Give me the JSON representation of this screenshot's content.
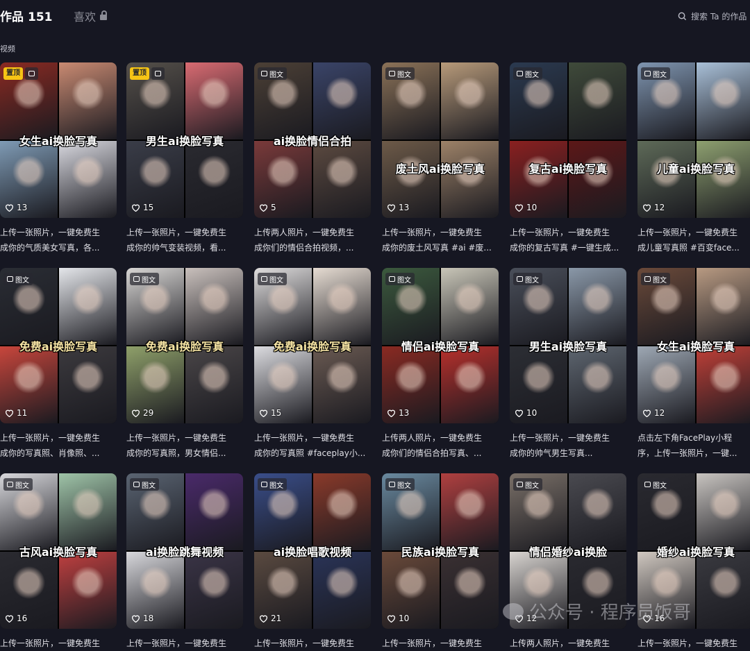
{
  "tabs": {
    "works_label": "作品",
    "works_count": "151",
    "likes_label": "喜欢"
  },
  "search": {
    "placeholder": "搜索 Ta 的作品"
  },
  "section_label": "视频",
  "cards": [
    {
      "pinned": true,
      "tag": "",
      "title": "女生ai换脸写真",
      "likes": "13",
      "desc1": "上传一张照片，一键免费生",
      "desc2": "成你的气质美女写真，各...",
      "colors": [
        "#8a2a22",
        "#c98a72",
        "#7f9bb5",
        "#d9d9e0"
      ],
      "title_style": "white",
      "title_pos": "mid"
    },
    {
      "pinned": true,
      "tag": "",
      "title": "男生ai换脸写真",
      "likes": "15",
      "desc1": "上传一张照片，一键免费生",
      "desc2": "成你的帅气变装视频，看...",
      "colors": [
        "#55504a",
        "#d96b72",
        "#3a3d48",
        "#2a2a30"
      ],
      "title_style": "white",
      "title_pos": "mid"
    },
    {
      "pinned": false,
      "tag": "图文",
      "title": "ai换脸情侣合拍",
      "likes": "5",
      "desc1": "上传两人照片，一键免费生",
      "desc2": "成你们的情侣合拍视频，...",
      "colors": [
        "#4c4036",
        "#3a4468",
        "#7a3a3a",
        "#5c4a40"
      ],
      "title_style": "white",
      "title_pos": "mid"
    },
    {
      "pinned": false,
      "tag": "图文",
      "title": "废土风ai换脸写真",
      "likes": "13",
      "desc1": "上传一张照片，一键免费生",
      "desc2": "成你的废土风写真 #ai #废...",
      "colors": [
        "#8b7258",
        "#b79a7a",
        "#6d5a48",
        "#9d8268"
      ],
      "title_style": "white",
      "title_pos": "low"
    },
    {
      "pinned": false,
      "tag": "图文",
      "title": "复古ai换脸写真",
      "likes": "10",
      "desc1": "上传一张照片，一键免费生",
      "desc2": "成你的复古写真 #一键生成...",
      "colors": [
        "#2b3a50",
        "#3f4a3a",
        "#8a2020",
        "#5c1818"
      ],
      "title_style": "white",
      "title_pos": "low"
    },
    {
      "pinned": false,
      "tag": "图文",
      "title": "儿童ai换脸写真",
      "likes": "12",
      "desc1": "上传一张照片，一键免费生",
      "desc2": "成儿童写真照 #百变face...",
      "colors": [
        "#7f95b0",
        "#a9c0d8",
        "#5e6a58",
        "#8ea070"
      ],
      "title_style": "white",
      "title_pos": "low"
    },
    {
      "pinned": false,
      "tag": "图文",
      "title": "免费ai换脸写真",
      "likes": "11",
      "desc1": "上传一张照片，一键免费生",
      "desc2": "成你的写真照、肖像照、...",
      "colors": [
        "#2a2d34",
        "#e4e6ea",
        "#c8463c",
        "#3c3a3e"
      ],
      "title_style": "gold",
      "title_pos": "mid"
    },
    {
      "pinned": false,
      "tag": "图文",
      "title": "免费ai换脸写真",
      "likes": "29",
      "desc1": "上传一张照片，一键免费生",
      "desc2": "成你的写真照，男女情侣...",
      "colors": [
        "#d8d6d4",
        "#c9c0bc",
        "#8fa06a",
        "#4a4648"
      ],
      "title_style": "gold",
      "title_pos": "mid"
    },
    {
      "pinned": false,
      "tag": "图文",
      "title": "免费ai换脸写真",
      "likes": "15",
      "desc1": "上传一张照片，一键免费生",
      "desc2": "成你的写真照 #faceplay小...",
      "colors": [
        "#e0dede",
        "#e6dcd2",
        "#dcdce0",
        "#6a5a52"
      ],
      "title_style": "gold",
      "title_pos": "mid"
    },
    {
      "pinned": false,
      "tag": "图文",
      "title": "情侣ai换脸写真",
      "likes": "13",
      "desc1": "上传两人照片，一键免费生",
      "desc2": "成你们的情侣合拍写真、...",
      "colors": [
        "#3c5a3e",
        "#c9c6b8",
        "#8a2a22",
        "#b8302c"
      ],
      "title_style": "white",
      "title_pos": "mid"
    },
    {
      "pinned": false,
      "tag": "图文",
      "title": "男生ai换脸写真",
      "likes": "10",
      "desc1": "上传一张照片，一键免费生",
      "desc2": "成你的帅气男生写真...",
      "colors": [
        "#4a4f5a",
        "#8a98a8",
        "#2c2e34",
        "#5e6670"
      ],
      "title_style": "white",
      "title_pos": "mid"
    },
    {
      "pinned": false,
      "tag": "图文",
      "title": "女生ai换脸写真",
      "likes": "12",
      "desc1": "点击左下角FacePlay小程",
      "desc2": "序，上传一张照片，一键...",
      "colors": [
        "#6b4a3a",
        "#b89a82",
        "#9ea8b4",
        "#c04038"
      ],
      "title_style": "white",
      "title_pos": "mid"
    },
    {
      "pinned": false,
      "tag": "图文",
      "title": "古风ai换脸写真",
      "likes": "16",
      "desc1": "上传一张照片，一键免费生",
      "desc2": "",
      "colors": [
        "#d8d8dc",
        "#9fc4a8",
        "#2a2a30",
        "#c04040"
      ],
      "title_style": "white",
      "title_pos": "mid"
    },
    {
      "pinned": false,
      "tag": "图文",
      "title": "ai换脸跳舞视频",
      "likes": "18",
      "desc1": "上传一张照片，一键免费生",
      "desc2": "",
      "colors": [
        "#5a6472",
        "#4a2a6a",
        "#d8d8dc",
        "#3a3446"
      ],
      "title_style": "white",
      "title_pos": "mid"
    },
    {
      "pinned": false,
      "tag": "图文",
      "title": "ai换脸唱歌视频",
      "likes": "21",
      "desc1": "上传一张照片，一键免费生",
      "desc2": "",
      "colors": [
        "#3a4e8a",
        "#8a3a2a",
        "#5a4a40",
        "#2a3458"
      ],
      "title_style": "white",
      "title_pos": "mid"
    },
    {
      "pinned": false,
      "tag": "图文",
      "title": "民族ai换脸写真",
      "likes": "10",
      "desc1": "上传一张照片，一键免费生",
      "desc2": "",
      "colors": [
        "#6a8aa0",
        "#b04040",
        "#6a4a3a",
        "#3a3032"
      ],
      "title_style": "white",
      "title_pos": "mid"
    },
    {
      "pinned": false,
      "tag": "图文",
      "title": "情侣婚纱ai换脸",
      "likes": "12",
      "desc1": "上传两人照片，一键免费生",
      "desc2": "",
      "colors": [
        "#7a7068",
        "#4a4a50",
        "#d8d4d0",
        "#2a2a30"
      ],
      "title_style": "white",
      "title_pos": "mid"
    },
    {
      "pinned": false,
      "tag": "图文",
      "title": "婚纱ai换脸写真",
      "likes": "16",
      "desc1": "上传一张照片，一键免费生",
      "desc2": "",
      "colors": [
        "#2a2a30",
        "#c8c4c0",
        "#d0c8c0",
        "#3a3a40"
      ],
      "title_style": "white",
      "title_pos": "mid"
    }
  ],
  "pin_label": "置顶",
  "watermark": {
    "text": "公众号 · 程序员饭哥"
  }
}
